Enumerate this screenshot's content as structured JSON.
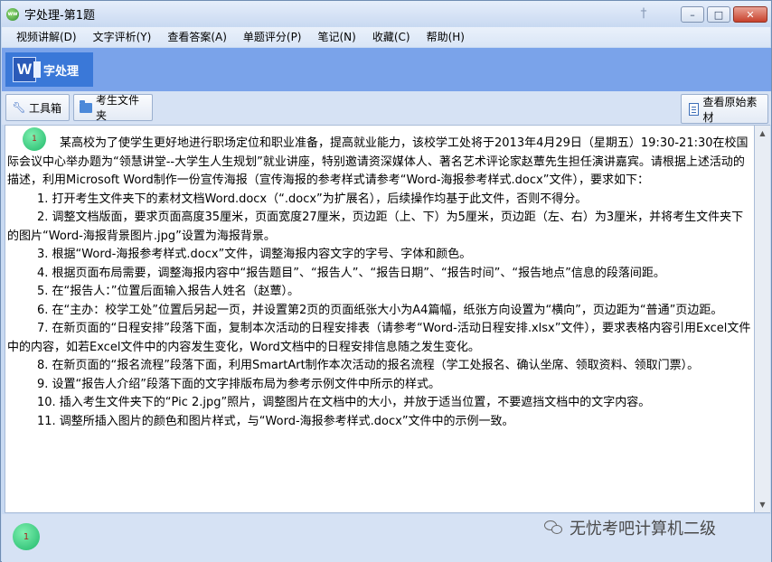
{
  "window": {
    "title": "字处理-第1题",
    "app_icon_label": "ww"
  },
  "menubar": {
    "items": [
      {
        "label": "视频讲解(D)"
      },
      {
        "label": "文字评析(Y)"
      },
      {
        "label": "查看答案(A)"
      },
      {
        "label": "单题评分(P)"
      },
      {
        "label": "笔记(N)"
      },
      {
        "label": "收藏(C)"
      },
      {
        "label": "帮助(H)"
      }
    ]
  },
  "banner": {
    "label": "字处理",
    "icon_letter": "W",
    "color": "#7aa3ea",
    "tile_color": "#3a78d8"
  },
  "toolbar": {
    "tools_label": "工具箱",
    "folder_label": "考生文件夹",
    "origin_label": "查看原始素材"
  },
  "question": {
    "badge": "1",
    "intro": "某高校为了使学生更好地进行职场定位和职业准备，提高就业能力，该校学工处将于2013年4月29日（星期五）19:30-21:30在校国际会议中心举办题为“领慧讲堂--大学生人生规划”就业讲座，特别邀请资深媒体人、著名艺术评论家赵蕈先生担任演讲嘉宾。请根据上述活动的描述，利用Microsoft Word制作一份宣传海报（宣传海报的参考样式请参考“Word-海报参考样式.docx”文件），要求如下：",
    "items": [
      "1. 打开考生文件夹下的素材文档Word.docx（“.docx”为扩展名），后续操作均基于此文件，否则不得分。",
      "2. 调整文档版面，要求页面高度35厘米，页面宽度27厘米，页边距（上、下）为5厘米，页边距（左、右）为3厘米，并将考生文件夹下的图片“Word-海报背景图片.jpg”设置为海报背景。",
      "3. 根据“Word-海报参考样式.docx”文件，调整海报内容文字的字号、字体和颜色。",
      "4. 根据页面布局需要，调整海报内容中“报告题目”、“报告人”、“报告日期”、“报告时间”、“报告地点”信息的段落间距。",
      "5. 在“报告人：”位置后面输入报告人姓名（赵蕈）。",
      "6. 在“主办：校学工处”位置后另起一页，并设置第2页的页面纸张大小为A4篇幅，纸张方向设置为“横向”，页边距为“普通”页边距。",
      "7. 在新页面的“日程安排”段落下面，复制本次活动的日程安排表（请参考“Word-活动日程安排.xlsx”文件），要求表格内容引用Excel文件中的内容，如若Excel文件中的内容发生变化，Word文档中的日程安排信息随之发生变化。",
      "8. 在新页面的“报名流程”段落下面，利用SmartArt制作本次活动的报名流程（学工处报名、确认坐席、领取资料、领取门票）。",
      "9. 设置“报告人介绍”段落下面的文字排版布局为参考示例文件中所示的样式。",
      "10. 插入考生文件夹下的“Pic 2.jpg”照片，调整图片在文档中的大小，并放于适当位置，不要遮挡文档中的文字内容。",
      "11. 调整所插入图片的颜色和图片样式，与“Word-海报参考样式.docx”文件中的示例一致。"
    ]
  },
  "footer": {
    "badge": "1",
    "watermark": "无忧考吧计算机二级"
  }
}
